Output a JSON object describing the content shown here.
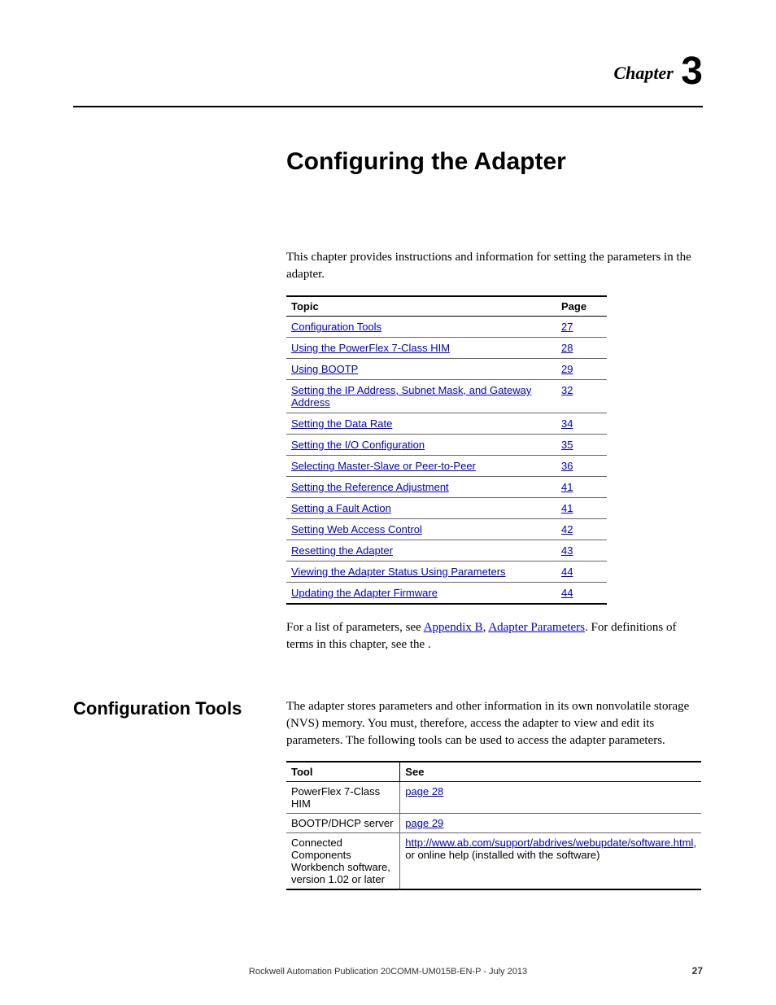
{
  "chapter": {
    "label": "Chapter",
    "number": "3"
  },
  "title": "Configuring the Adapter",
  "intro": "This chapter provides instructions and information for setting the parameters in the adapter.",
  "toc": {
    "headers": {
      "topic": "Topic",
      "page": "Page"
    },
    "rows": [
      {
        "topic": "Configuration Tools",
        "page": "27"
      },
      {
        "topic": "Using the PowerFlex 7-Class HIM",
        "page": "28"
      },
      {
        "topic": "Using BOOTP",
        "page": "29"
      },
      {
        "topic": "Setting the IP Address, Subnet Mask, and Gateway Address",
        "page": "32"
      },
      {
        "topic": "Setting the Data Rate",
        "page": "34"
      },
      {
        "topic": "Setting the I/O Configuration",
        "page": "35"
      },
      {
        "topic": "Selecting Master-Slave or Peer-to-Peer",
        "page": "36"
      },
      {
        "topic": "Setting the Reference Adjustment",
        "page": "41"
      },
      {
        "topic": "Setting a Fault Action",
        "page": "41"
      },
      {
        "topic": "Setting Web Access Control",
        "page": "42"
      },
      {
        "topic": "Resetting the Adapter",
        "page": "43"
      },
      {
        "topic": "Viewing the Adapter Status Using Parameters",
        "page": "44"
      },
      {
        "topic": "Updating the Adapter Firmware",
        "page": "44"
      }
    ]
  },
  "post_toc": {
    "prefix": "For a list of parameters, see ",
    "appendix": "Appendix B",
    "comma": ", ",
    "adapter_params": "Adapter Parameters",
    "suffix": ". For definitions of terms in this chapter, see the ."
  },
  "section": {
    "heading": "Configuration Tools",
    "body": "The adapter stores parameters and other information in its own nonvolatile storage (NVS) memory. You must, therefore, access the adapter to view and edit its parameters. The following tools can be used to access the adapter parameters."
  },
  "tool_table": {
    "headers": {
      "tool": "Tool",
      "see": "See"
    },
    "rows": [
      {
        "tool": "PowerFlex 7-Class HIM",
        "see_link": "page 28",
        "see_suffix": ""
      },
      {
        "tool": "BOOTP/DHCP server",
        "see_link": "page 29",
        "see_suffix": ""
      },
      {
        "tool": "Connected Components Workbench software, version 1.02 or later",
        "see_link": "http://www.ab.com/support/abdrives/webupdate/software.html",
        "see_suffix": ", or online help (installed with the software)"
      }
    ]
  },
  "footer": {
    "text": "Rockwell Automation Publication 20COMM-UM015B-EN-P - July 2013",
    "page": "27"
  }
}
